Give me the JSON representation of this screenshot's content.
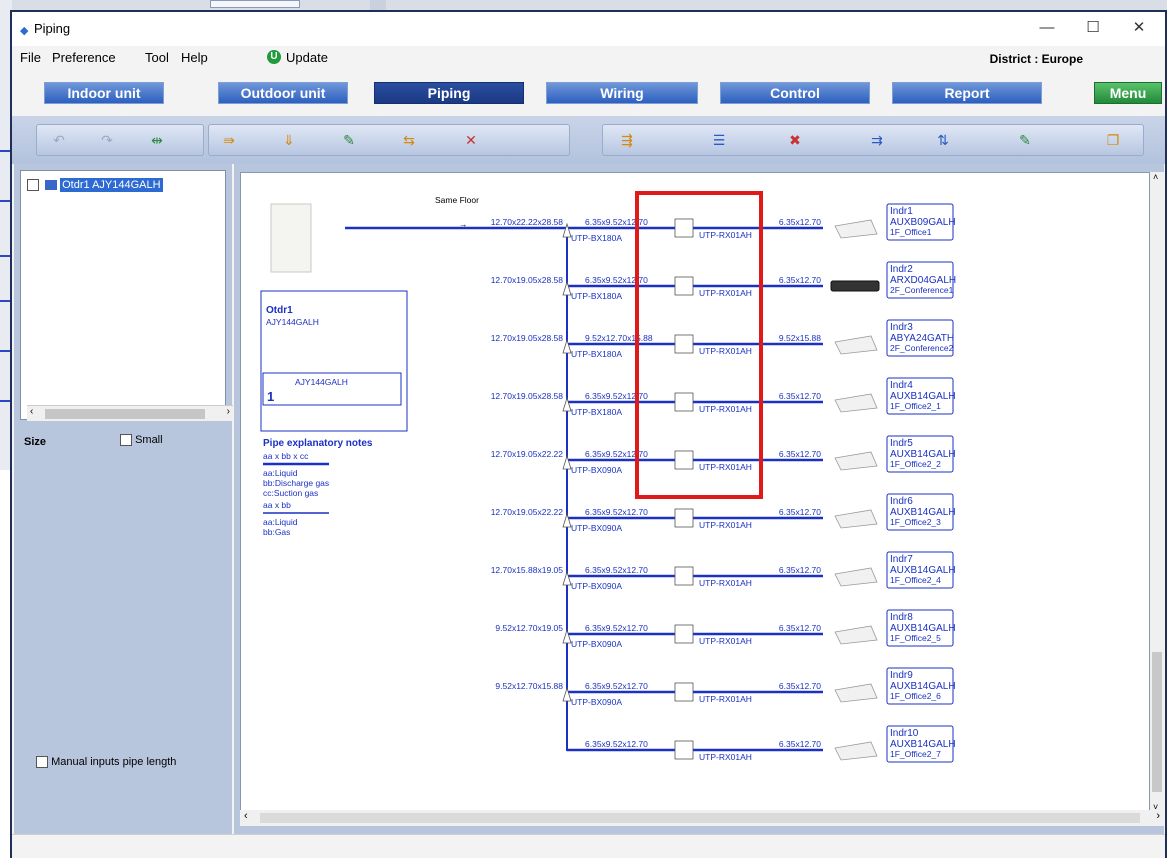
{
  "window": {
    "title": "Piping",
    "controls": [
      "—",
      "☐",
      "✕"
    ]
  },
  "menubar": {
    "items": [
      "File",
      "Preference",
      "Tool",
      "Help"
    ],
    "update_label": "Update",
    "district": "District : Europe"
  },
  "nav_tabs": [
    "Indoor unit",
    "Outdoor unit",
    "Piping",
    "Wiring",
    "Control",
    "Report",
    "Menu"
  ],
  "tree": {
    "item_label": "Otdr1 AJY144GALH"
  },
  "left_panel": {
    "size_label": "Size",
    "small_label": "Small",
    "manual_label": "Manual inputs pipe length"
  },
  "diagram": {
    "same_floor": "Same Floor",
    "outdoor": {
      "name": "Otdr1",
      "model": "AJY144GALH",
      "box_model": "AJY144GALH",
      "box_count": "1"
    },
    "notes": {
      "title": "Pipe explanatory notes",
      "fmt1": "aa x bb x cc",
      "fmt1_lines": [
        "aa:Liquid",
        "bb:Discharge gas",
        "cc:Suction gas"
      ],
      "fmt2": "aa x bb",
      "fmt2_lines": [
        "aa:Liquid",
        "bb:Gas"
      ]
    },
    "main_pipes": [
      "12.70x22.22x28.58",
      "12.70x19.05x28.58",
      "12.70x19.05x28.58",
      "12.70x19.05x28.58",
      "12.70x19.05x22.22",
      "12.70x19.05x22.22",
      "12.70x15.88x19.05",
      "9.52x12.70x19.05",
      "9.52x12.70x15.88"
    ],
    "branch_kits": [
      "UTP-BX180A",
      "UTP-BX180A",
      "UTP-BX180A",
      "UTP-BX180A",
      "UTP-BX090A",
      "UTP-BX090A",
      "UTP-BX090A",
      "UTP-BX090A",
      "UTP-BX090A"
    ],
    "branch_pipes": [
      "6.35x9.52x12.70",
      "6.35x9.52x12.70",
      "9.52x12.70x15.88",
      "6.35x9.52x12.70",
      "6.35x9.52x12.70",
      "6.35x9.52x12.70",
      "6.35x9.52x12.70",
      "6.35x9.52x12.70",
      "6.35x9.52x12.70",
      "6.35x9.52x12.70"
    ],
    "rx_kits": [
      "UTP-RX01AH",
      "UTP-RX01AH",
      "UTP-RX01AH",
      "UTP-RX01AH",
      "UTP-RX01AH",
      "UTP-RX01AH",
      "UTP-RX01AH",
      "UTP-RX01AH",
      "UTP-RX01AH",
      "UTP-RX01AH"
    ],
    "indoor_pipes": [
      "6.35x12.70",
      "6.35x12.70",
      "9.52x15.88",
      "6.35x12.70",
      "6.35x12.70",
      "6.35x12.70",
      "6.35x12.70",
      "6.35x12.70",
      "6.35x12.70",
      "6.35x12.70"
    ],
    "indoor_units": [
      {
        "name": "Indr1",
        "model": "AUXB09GALH",
        "room": "1F_Office1"
      },
      {
        "name": "Indr2",
        "model": "ARXD04GALH",
        "room": "2F_Conference1"
      },
      {
        "name": "Indr3",
        "model": "ABYA24GATH",
        "room": "2F_Conference2"
      },
      {
        "name": "Indr4",
        "model": "AUXB14GALH",
        "room": "1F_Office2_1"
      },
      {
        "name": "Indr5",
        "model": "AUXB14GALH",
        "room": "1F_Office2_2"
      },
      {
        "name": "Indr6",
        "model": "AUXB14GALH",
        "room": "1F_Office2_3"
      },
      {
        "name": "Indr7",
        "model": "AUXB14GALH",
        "room": "1F_Office2_4"
      },
      {
        "name": "Indr8",
        "model": "AUXB14GALH",
        "room": "1F_Office2_5"
      },
      {
        "name": "Indr9",
        "model": "AUXB14GALH",
        "room": "1F_Office2_6"
      },
      {
        "name": "Indr10",
        "model": "AUXB14GALH",
        "room": "1F_Office2_7"
      }
    ]
  },
  "colors": {
    "pipe": "#1a31c4",
    "highlight": "#e01919",
    "nav_blue": "#2c5fbf",
    "menu_green": "#23893a"
  }
}
